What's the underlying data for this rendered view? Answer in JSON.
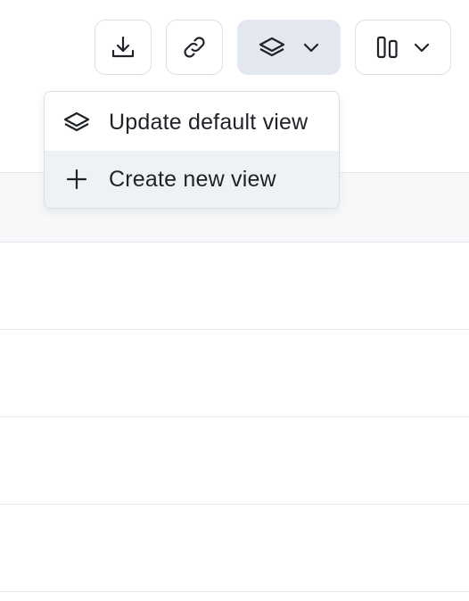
{
  "toolbar": {
    "buttons": [
      {
        "icon": "download-icon"
      },
      {
        "icon": "link-icon"
      },
      {
        "icon": "layers-icon",
        "state": "active",
        "dropdown": true
      },
      {
        "icon": "columns-icon",
        "dropdown": true
      }
    ]
  },
  "views_menu": {
    "items": [
      {
        "icon": "layers-icon",
        "label": "Update default view"
      },
      {
        "icon": "plus-icon",
        "label": "Create new view",
        "state": "hovered"
      }
    ]
  },
  "colors": {
    "active_button_bg": "#e3e7ef",
    "hover_item_bg": "#eef1f5",
    "header_bg": "#f6f8fa",
    "border": "#dcdfe4",
    "text": "#1f2328"
  }
}
